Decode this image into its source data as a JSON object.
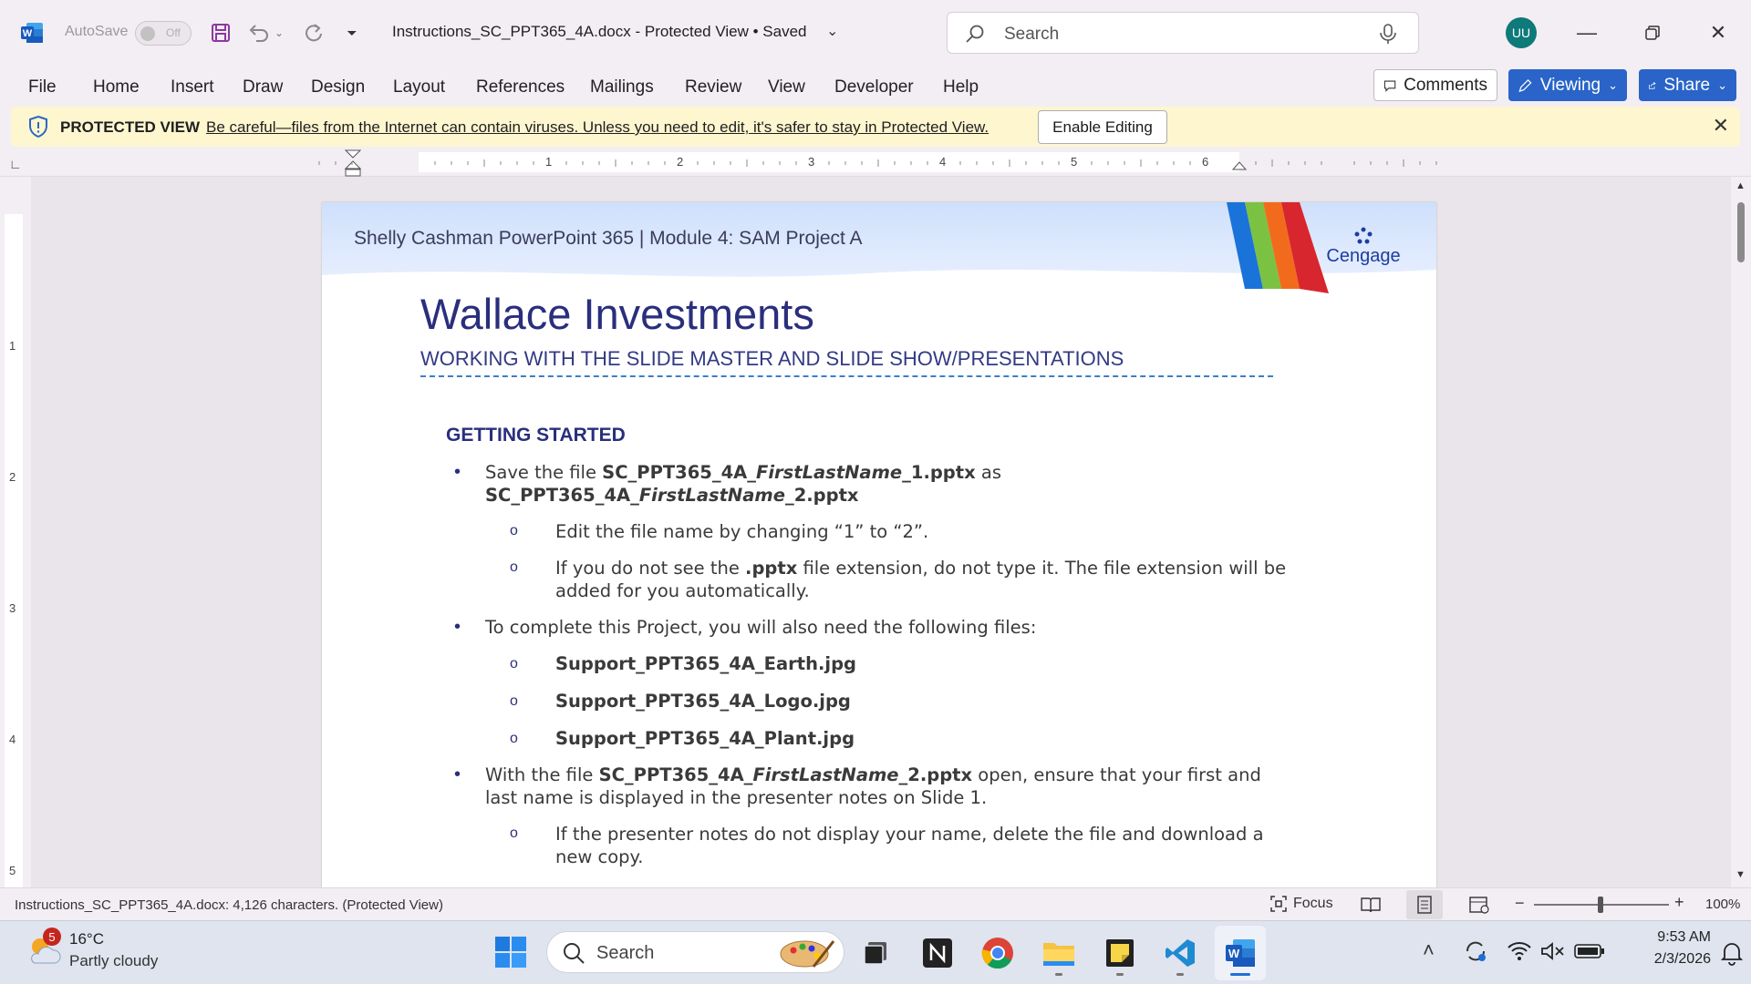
{
  "titlebar": {
    "autosave_label": "AutoSave",
    "autosave_state": "Off",
    "doc_title": "Instructions_SC_PPT365_4A.docx  -  Protected View • Saved",
    "search_placeholder": "Search",
    "user_initials": "UU"
  },
  "ribbon": {
    "tabs": [
      "File",
      "Home",
      "Insert",
      "Draw",
      "Design",
      "Layout",
      "References",
      "Mailings",
      "Review",
      "View",
      "Developer",
      "Help"
    ],
    "comments_label": "Comments",
    "viewing_label": "Viewing",
    "share_label": "Share"
  },
  "protected_view": {
    "label": "PROTECTED VIEW",
    "message": "Be careful—files from the Internet can contain viruses. Unless you need to edit, it's safer to stay in Protected View.",
    "enable_button": "Enable Editing"
  },
  "ruler": {
    "h_numbers": [
      "1",
      "2",
      "3",
      "4",
      "5",
      "6"
    ],
    "v_numbers": [
      "1",
      "2",
      "3",
      "4",
      "5"
    ]
  },
  "document": {
    "header_text": "Shelly Cashman PowerPoint 365  |  Module 4: SAM Project A",
    "logo_text": "Cengage",
    "title": "Wallace Investments",
    "subtitle": "WORKING WITH THE SLIDE MASTER AND SLIDE SHOW/PRESENTATIONS",
    "section": "GETTING STARTED",
    "b1_pre": "Save the file ",
    "b1_file1a": "SC_PPT365_4A_",
    "b1_file1b": "FirstLastName",
    "b1_file1c": "_1.pptx",
    "b1_as": " as",
    "b1_file2a": "SC_PPT365_4A_",
    "b1_file2b": "FirstLastName",
    "b1_file2c": "_2.pptx",
    "s1": "Edit the file name by changing “1” to “2”.",
    "s2_pre": "If you do not see the ",
    "s2_bold": ".pptx",
    "s2_post": " file extension, do not type it. The file extension will be",
    "s2_line2": "added for you automatically.",
    "b2": "To complete this Project, you will also need the following files:",
    "f1": "Support_PPT365_4A_Earth.jpg",
    "f2": "Support_PPT365_4A_Logo.jpg",
    "f3": "Support_PPT365_4A_Plant.jpg",
    "b3_pre": "With the file ",
    "b3_filea": "SC_PPT365_4A_",
    "b3_fileb": "FirstLastName",
    "b3_filec": "_2.pptx",
    "b3_post": " open, ensure that your first and",
    "b3_line2": "last name is displayed in the presenter notes on Slide 1.",
    "s3": "If the presenter notes do not display your name, delete the file and download a",
    "s3_line2": "new copy."
  },
  "statusbar": {
    "text": "Instructions_SC_PPT365_4A.docx: 4,126 characters.  (Protected View)",
    "focus_label": "Focus",
    "zoom": "100%"
  },
  "taskbar": {
    "weather_badge": "5",
    "temperature": "16°C",
    "condition": "Partly cloudy",
    "search_label": "Search",
    "time": "9:53 AM",
    "date": "2/3/2026"
  },
  "colors": {
    "accent_blue": "#2a64c8",
    "doc_navy": "#2a2e7d",
    "protected_bar": "#fdf6cf"
  }
}
